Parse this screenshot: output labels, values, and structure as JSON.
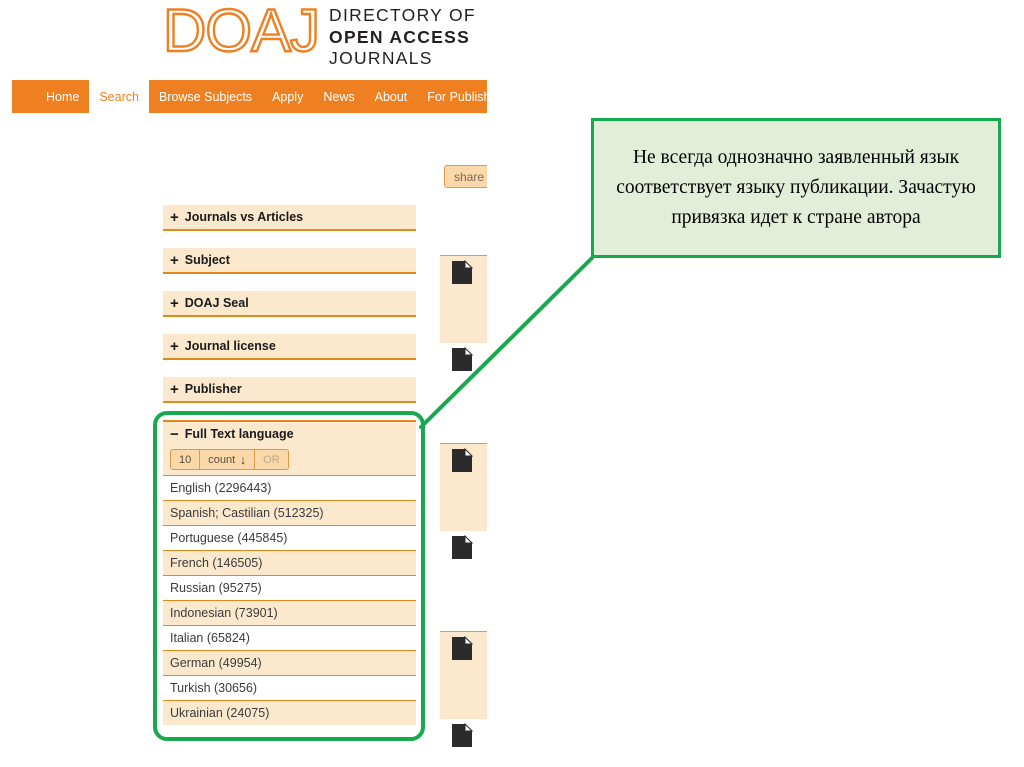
{
  "site": {
    "logo_wordmark": "DOAJ",
    "tagline_line1": "DIRECTORY OF",
    "tagline_line2": "OPEN ACCESS",
    "tagline_line3": "JOURNALS",
    "brand_color": "#ef8022"
  },
  "nav": {
    "items": [
      {
        "label": "Home",
        "active": false
      },
      {
        "label": "Search",
        "active": true
      },
      {
        "label": "Browse Subjects",
        "active": false
      },
      {
        "label": "Apply",
        "active": false
      },
      {
        "label": "News",
        "active": false
      },
      {
        "label": "About",
        "active": false
      },
      {
        "label": "For Publishers",
        "active": false
      }
    ]
  },
  "toolbar": {
    "share_label": "share"
  },
  "facets": {
    "collapsed": [
      {
        "icon": "plus-icon",
        "sign": "+",
        "label": "Journals vs Articles"
      },
      {
        "icon": "plus-icon",
        "sign": "+",
        "label": "Subject"
      },
      {
        "icon": "plus-icon",
        "sign": "+",
        "label": "DOAJ Seal"
      },
      {
        "icon": "plus-icon",
        "sign": "+",
        "label": "Journal license"
      },
      {
        "icon": "plus-icon",
        "sign": "+",
        "label": "Publisher"
      }
    ],
    "language": {
      "icon": "minus-icon",
      "sign": "−",
      "label": "Full Text language",
      "controls": {
        "size": "10",
        "sort_label": "count",
        "sort_arrow": "↓",
        "operator": "OR"
      },
      "items": [
        {
          "label": "English (2296443)",
          "name": "English",
          "count": 2296443
        },
        {
          "label": "Spanish; Castilian (512325)",
          "name": "Spanish; Castilian",
          "count": 512325
        },
        {
          "label": "Portuguese (445845)",
          "name": "Portuguese",
          "count": 445845
        },
        {
          "label": "French (146505)",
          "name": "French",
          "count": 146505
        },
        {
          "label": "Russian (95275)",
          "name": "Russian",
          "count": 95275
        },
        {
          "label": "Indonesian (73901)",
          "name": "Indonesian",
          "count": 73901
        },
        {
          "label": "Italian (65824)",
          "name": "Italian",
          "count": 65824
        },
        {
          "label": "German (49954)",
          "name": "German",
          "count": 49954
        },
        {
          "label": "Turkish (30656)",
          "name": "Turkish",
          "count": 30656
        },
        {
          "label": "Ukrainian (24075)",
          "name": "Ukrainian",
          "count": 24075
        }
      ],
      "highlight_color": "#16a94e"
    }
  },
  "results": {
    "rows": [
      {
        "icon": "document-icon"
      },
      {
        "icon": "document-icon"
      },
      {
        "icon": "document-icon"
      },
      {
        "icon": "document-icon"
      },
      {
        "icon": "document-icon"
      },
      {
        "icon": "document-icon"
      }
    ]
  },
  "callout": {
    "text": "Не всегда однозначно заявленный язык соответствует языку публикации. Зачастую привязка идет к стране автора",
    "border_color": "#16a94e",
    "background_color": "#e2eed8"
  }
}
